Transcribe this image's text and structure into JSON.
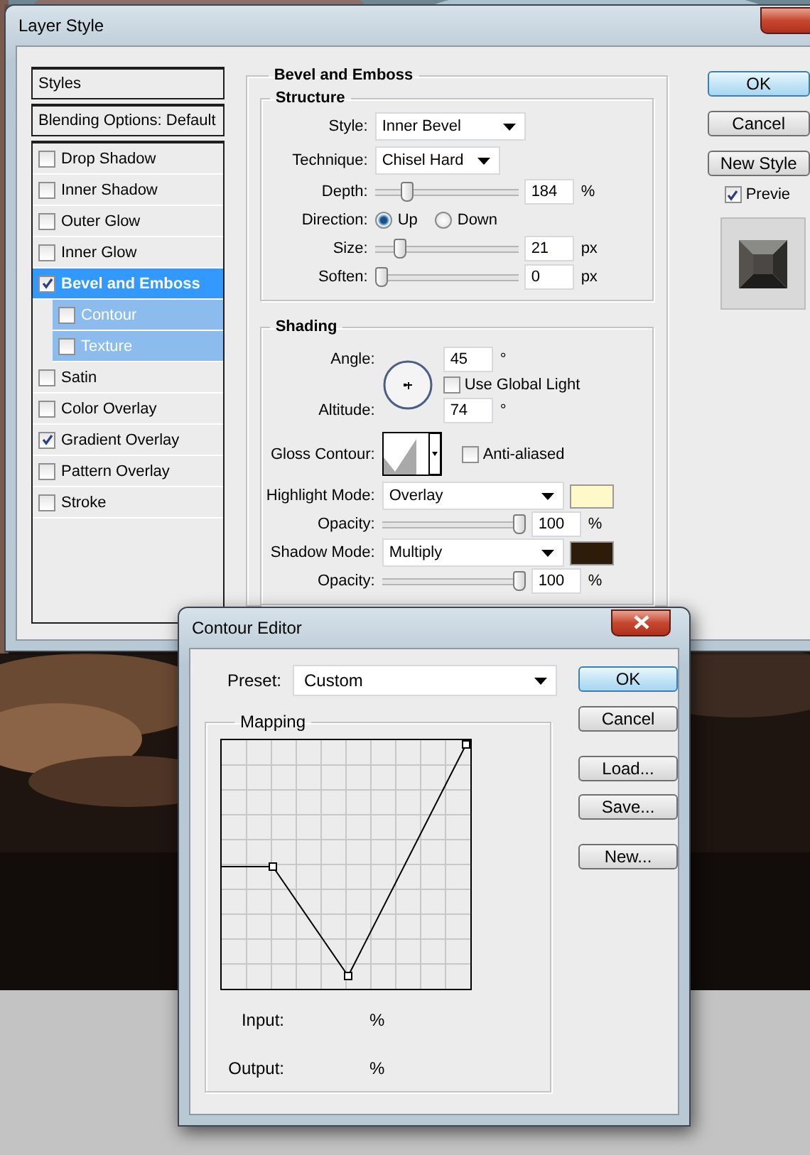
{
  "layer_style": {
    "title": "Layer Style",
    "styles_list": {
      "header": "Styles",
      "blending": "Blending Options: Default",
      "items": [
        {
          "label": "Drop Shadow",
          "checked": false,
          "selected": false
        },
        {
          "label": "Inner Shadow",
          "checked": false,
          "selected": false
        },
        {
          "label": "Outer Glow",
          "checked": false,
          "selected": false
        },
        {
          "label": "Inner Glow",
          "checked": false,
          "selected": false
        },
        {
          "label": "Bevel and Emboss",
          "checked": true,
          "selected": true,
          "children": [
            {
              "label": "Contour",
              "checked": false,
              "selected": false
            },
            {
              "label": "Texture",
              "checked": false,
              "selected": false
            }
          ]
        },
        {
          "label": "Satin",
          "checked": false,
          "selected": false
        },
        {
          "label": "Color Overlay",
          "checked": false,
          "selected": false
        },
        {
          "label": "Gradient Overlay",
          "checked": true,
          "selected": false
        },
        {
          "label": "Pattern Overlay",
          "checked": false,
          "selected": false
        },
        {
          "label": "Stroke",
          "checked": false,
          "selected": false
        }
      ]
    },
    "panel": {
      "title": "Bevel and Emboss",
      "structure": {
        "title": "Structure",
        "rows": [
          {
            "kind": "dropdown",
            "label": "Style:",
            "value": "Inner Bevel"
          },
          {
            "kind": "dropdown",
            "label": "Technique:",
            "value": "Chisel Hard"
          },
          {
            "kind": "slider",
            "label": "Depth:",
            "level": 0.2,
            "value": "184",
            "unit": "%"
          },
          {
            "kind": "radio",
            "label": "Direction:",
            "options": [
              {
                "label": "Up",
                "selected": true
              },
              {
                "label": "Down",
                "selected": false
              }
            ]
          },
          {
            "kind": "slider",
            "label": "Size:",
            "level": 0.14,
            "value": "21",
            "unit": "px"
          },
          {
            "kind": "slider",
            "label": "Soften:",
            "level": 0,
            "value": "0",
            "unit": "px"
          }
        ]
      },
      "shading": {
        "title": "Shading",
        "angle": {
          "label": "Angle:",
          "value": "45",
          "unit": "°"
        },
        "global_light": {
          "label": "Use Global Light",
          "checked": false
        },
        "altitude": {
          "label": "Altitude:",
          "value": "74",
          "unit": "°"
        },
        "gloss_contour": {
          "label": "Gloss Contour:"
        },
        "anti_aliased": {
          "label": "Anti-aliased",
          "checked": false
        },
        "rows": [
          {
            "kind": "mode",
            "label": "Highlight Mode:",
            "value": "Overlay",
            "color": "#fff8c8"
          },
          {
            "kind": "slider",
            "label": "Opacity:",
            "level": 1,
            "value": "100",
            "unit": "%"
          },
          {
            "kind": "mode",
            "label": "Shadow Mode:",
            "value": "Multiply",
            "color": "#2e1c0a"
          },
          {
            "kind": "slider",
            "label": "Opacity:",
            "level": 1,
            "value": "100",
            "unit": "%"
          }
        ]
      }
    },
    "buttons": [
      {
        "label": "OK",
        "default": true
      },
      {
        "label": "Cancel",
        "default": false
      },
      {
        "label": "New Style",
        "default": false
      }
    ],
    "preview": {
      "label": "Previe",
      "checked": true
    }
  },
  "contour_editor": {
    "title": "Contour Editor",
    "preset": {
      "label": "Preset:",
      "value": "Custom"
    },
    "mapping": {
      "title": "Mapping",
      "input": {
        "label": "Input:",
        "unit": "%"
      },
      "output": {
        "label": "Output:",
        "unit": "%"
      }
    },
    "buttons": [
      {
        "label": "OK",
        "default": true
      },
      {
        "label": "Cancel",
        "default": false
      },
      {
        "label": "Load...",
        "default": false
      },
      {
        "label": "Save...",
        "default": false
      },
      {
        "label": "New...",
        "default": false
      }
    ]
  }
}
